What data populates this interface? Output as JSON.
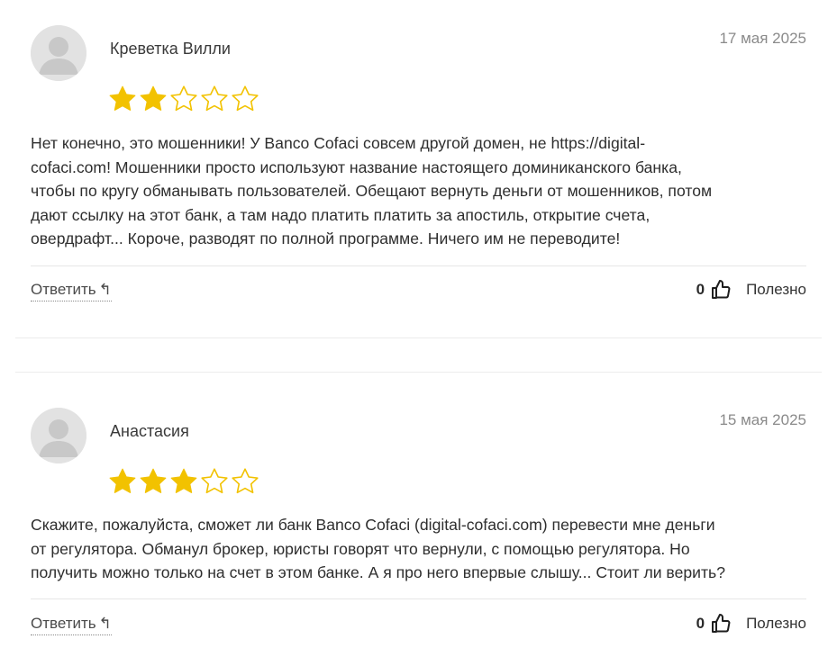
{
  "reviews": [
    {
      "author": "Креветка Вилли",
      "date": "17 мая 2025",
      "rating": 2,
      "max_rating": 5,
      "lines": [
        "Нет конечно, это мошенники! У Banco Cofaci совсем другой домен, не https://digital-",
        "cofaci.com! Мошенники просто используют название настоящего доминиканского банка,",
        "чтобы по кругу обманывать пользователей. Обещают вернуть деньги от мошенников, потом",
        "дают ссылку на этот банк, а там надо платить платить за апостиль, открытие счета,",
        "овердрафт... Короче, разводят по полной программе. Ничего им не переводите!"
      ],
      "reply_label": "Ответить",
      "reply_icon": "reply-arrow-icon",
      "helpful_count": "0",
      "helpful_label": "Полезно"
    },
    {
      "author": "Анастасия",
      "date": "15 мая 2025",
      "rating": 3,
      "max_rating": 5,
      "lines": [
        "Скажите, пожалуйста, сможет ли банк Banco Cofaci (digital-cofaci.com) перевести мне деньги",
        "от регулятора. Обманул брокер, юристы говорят что вернули, с помощью регулятора. Но",
        "получить можно только на счет в этом банке. А я про него впервые слышу... Стоит ли верить?"
      ],
      "reply_label": "Ответить",
      "reply_icon": "reply-arrow-icon",
      "helpful_count": "0",
      "helpful_label": "Полезно"
    }
  ],
  "colors": {
    "star_filled": "#f2c200",
    "star_empty": "#f2c200",
    "text": "#2e2e2e",
    "muted": "#8a8a8a"
  }
}
